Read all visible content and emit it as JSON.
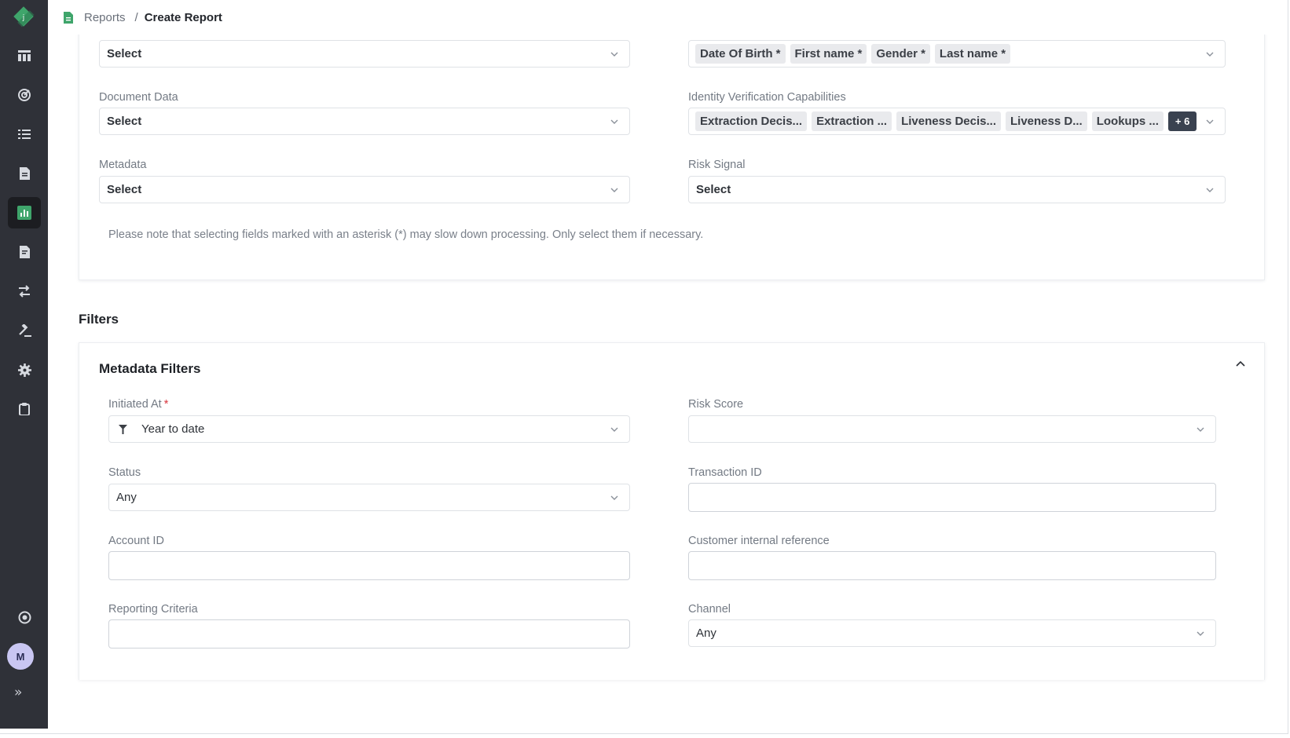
{
  "breadcrumb": {
    "parent": "Reports",
    "separator": "/",
    "current": "Create Report"
  },
  "sidebar": {
    "items": [
      {
        "icon": "logo-diamond-icon",
        "active": false
      },
      {
        "icon": "dashboard-icon",
        "active": false
      },
      {
        "icon": "analytics-icon",
        "active": false
      },
      {
        "icon": "list-icon",
        "active": false
      },
      {
        "icon": "document-icon",
        "active": false
      },
      {
        "icon": "reports-chart-icon",
        "active": true
      },
      {
        "icon": "file-icon",
        "active": false
      },
      {
        "icon": "workflow-icon",
        "active": false
      },
      {
        "icon": "gavel-icon",
        "active": false
      },
      {
        "icon": "settings-gear-icon",
        "active": false
      },
      {
        "icon": "clipboard-icon",
        "active": false
      },
      {
        "icon": "help-icon",
        "active": false
      }
    ],
    "avatar_initial": "M",
    "expand_label": "»"
  },
  "fields": {
    "top_left_value": "Select",
    "top_right_tags": [
      "Date Of Birth *",
      "First name *",
      "Gender *",
      "Last name *"
    ],
    "document_data": {
      "label": "Document Data",
      "value": "Select"
    },
    "id_verification": {
      "label": "Identity Verification Capabilities",
      "tags": [
        "Extraction Decis...",
        "Extraction ...",
        "Liveness Decis...",
        "Liveness D...",
        "Lookups ..."
      ],
      "more": "+ 6"
    },
    "metadata": {
      "label": "Metadata",
      "value": "Select"
    },
    "risk_signal": {
      "label": "Risk Signal",
      "value": "Select"
    },
    "note": "Please note that selecting fields marked with an asterisk (*) may slow down processing. Only select them if necessary."
  },
  "filters": {
    "section_title": "Filters",
    "card_title": "Metadata Filters",
    "initiated_at": {
      "label": "Initiated At",
      "required_mark": "*",
      "value": "Year to date"
    },
    "risk_score": {
      "label": "Risk Score",
      "value": ""
    },
    "status": {
      "label": "Status",
      "value": "Any"
    },
    "transaction_id": {
      "label": "Transaction ID",
      "value": ""
    },
    "account_id": {
      "label": "Account ID",
      "value": ""
    },
    "customer_ref": {
      "label": "Customer internal reference",
      "value": ""
    },
    "reporting_criteria": {
      "label": "Reporting Criteria",
      "value": ""
    },
    "channel": {
      "label": "Channel",
      "value": "Any"
    }
  },
  "colors": {
    "sidebar_bg": "#2f3138",
    "accent_green": "#3fa56b",
    "tag_more_bg": "#3a4250"
  }
}
